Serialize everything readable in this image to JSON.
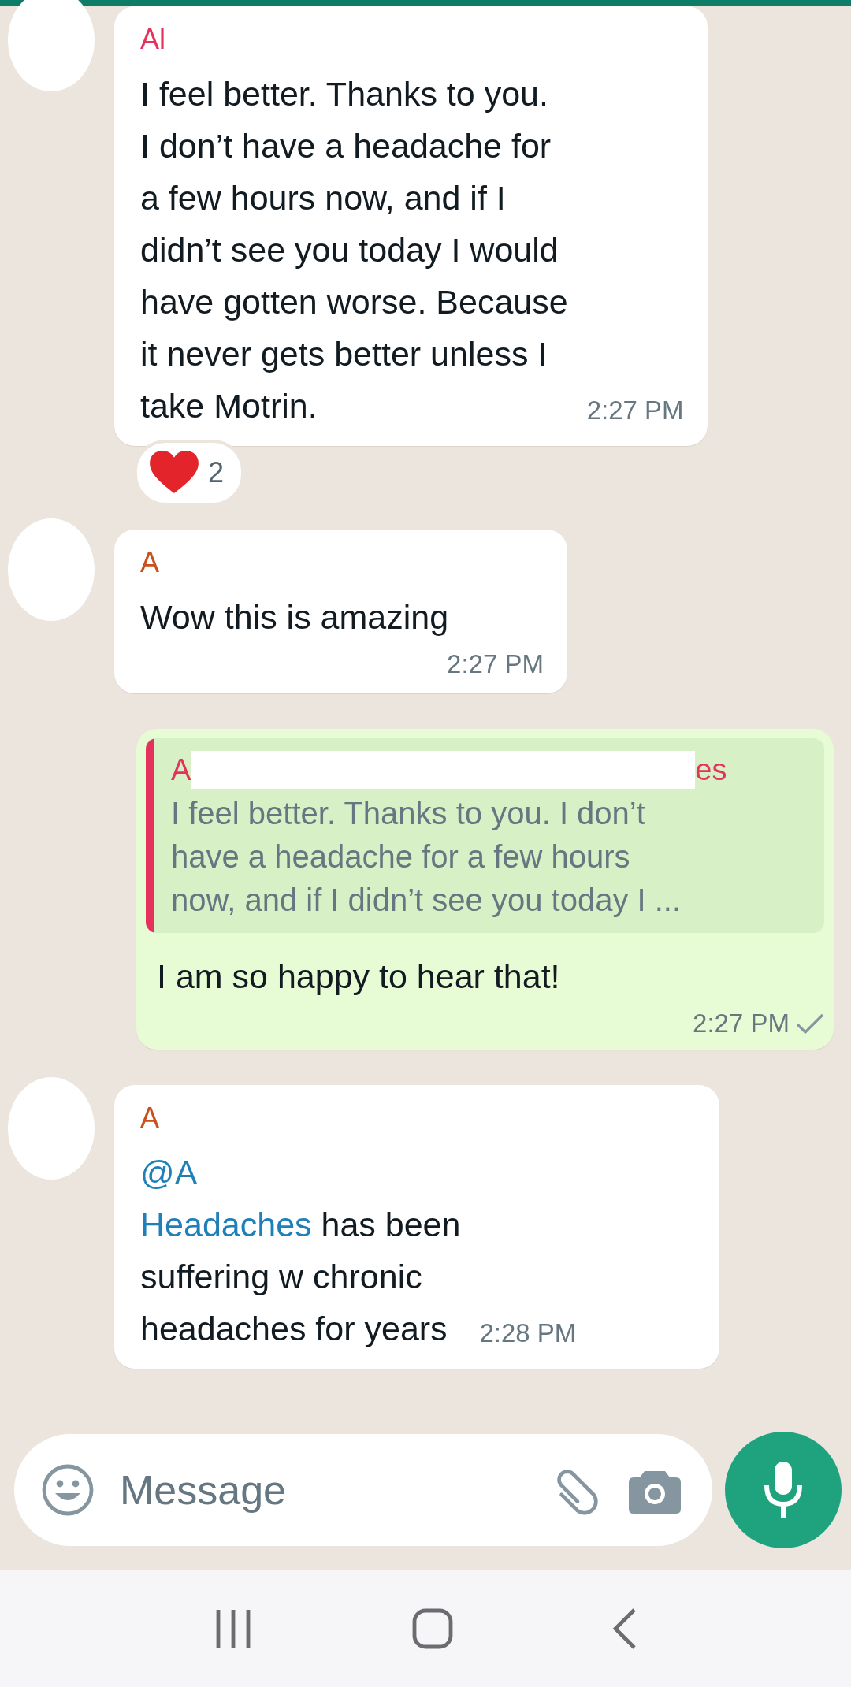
{
  "messages": [
    {
      "kind": "incoming",
      "sender": "Al",
      "color": "#e5325c",
      "body": [
        {
          "kind": "plain",
          "text": "I feel better. Thanks to you.\nI don’t have a headache for\na few hours now, and if I\ndidn’t see you today I would\nhave gotten worse. Because\nit never gets better unless I\ntake Motrin."
        }
      ],
      "time": "2:27 PM",
      "inline_time": true,
      "reaction": {
        "count": "2"
      }
    },
    {
      "kind": "incoming",
      "sender": "A",
      "color": "#c9501c",
      "body": [
        {
          "kind": "plain",
          "text": "Wow this is amazing"
        }
      ],
      "time": "2:27 PM",
      "inline_time": false
    },
    {
      "kind": "outgoing",
      "quote": {
        "author_start": "A",
        "author_end": "es",
        "color": "#e5325c",
        "text": "I feel better. Thanks to you. I don’t\nhave a headache for a few hours\nnow, and if I didn’t see you today I ..."
      },
      "body": [
        {
          "kind": "plain",
          "text": "I am so happy to hear that!"
        }
      ],
      "time": "2:27 PM",
      "read": false
    },
    {
      "kind": "incoming",
      "sender": "A",
      "color": "#c9501c",
      "body": [
        {
          "kind": "mention_line",
          "text": "@A"
        },
        {
          "kind": "mention",
          "text": "Headaches"
        },
        {
          "kind": "plain",
          "text": " has been\nsuffering w chronic\nheadaches for years"
        }
      ],
      "time": "2:28 PM",
      "inline_time": true
    }
  ],
  "composer": {
    "placeholder": "Message"
  }
}
